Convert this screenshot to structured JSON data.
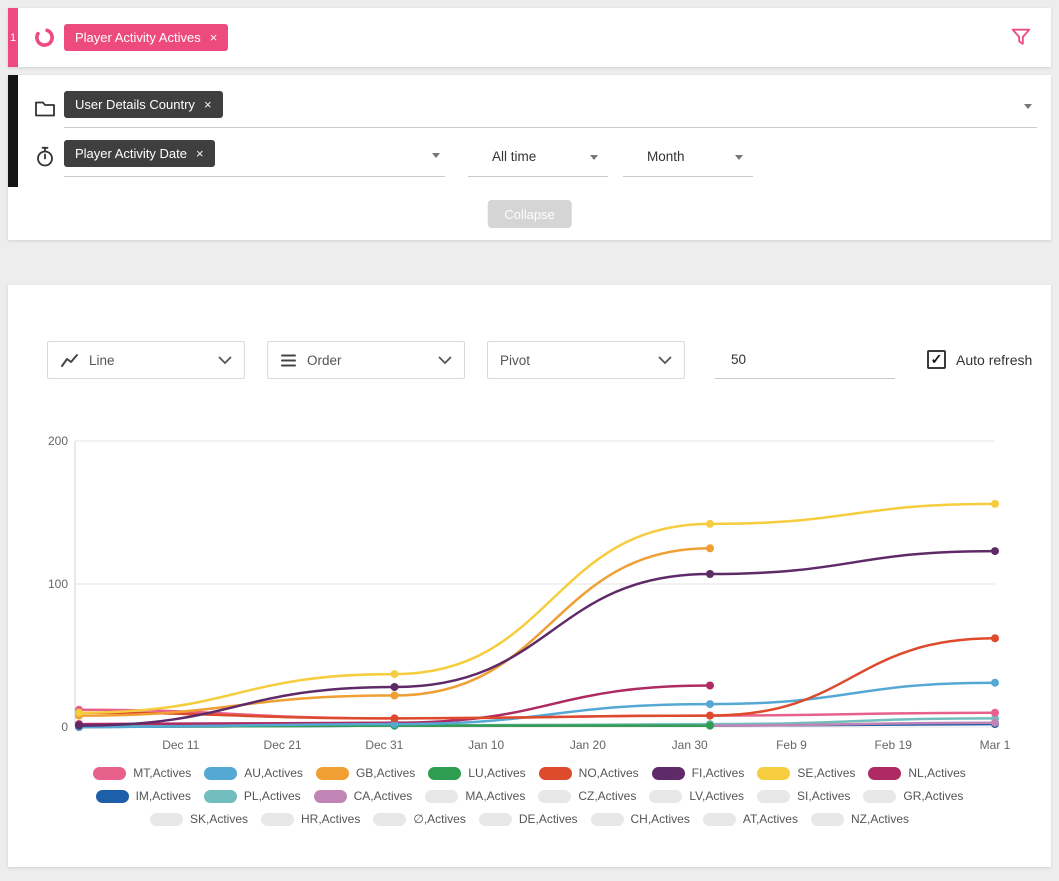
{
  "ui": {
    "row_number": "1",
    "close_glyph": "×",
    "check_glyph": "✓"
  },
  "query_builder": {
    "measure_chip": {
      "label": "Player Activity Actives"
    },
    "dimension_chip": {
      "label": "User Details Country"
    },
    "time_chip": {
      "label": "Player Activity Date"
    },
    "date_range": "All time",
    "granularity": "Month",
    "collapse_label": "Collapse"
  },
  "chart_controls": {
    "chart_type": "Line",
    "order_label": "Order",
    "pivot_label": "Pivot",
    "limit": "50",
    "auto_refresh_label": "Auto refresh"
  },
  "chart_data": {
    "type": "line",
    "title": "",
    "x": [
      "Dec 1",
      "Jan 1",
      "Feb 1",
      "Mar 1"
    ],
    "x_day_offsets": [
      0,
      31,
      62,
      90
    ],
    "x_ticks": [
      {
        "label": "Dec 11",
        "day": 10
      },
      {
        "label": "Dec 21",
        "day": 20
      },
      {
        "label": "Dec 31",
        "day": 30
      },
      {
        "label": "Jan 10",
        "day": 40
      },
      {
        "label": "Jan 20",
        "day": 50
      },
      {
        "label": "Jan 30",
        "day": 60
      },
      {
        "label": "Feb 9",
        "day": 70
      },
      {
        "label": "Feb 19",
        "day": 80
      },
      {
        "label": "Mar 1",
        "day": 90
      }
    ],
    "ylim": [
      0,
      200
    ],
    "y_ticks": [
      0,
      100,
      200
    ],
    "grid": true,
    "legend_position": "bottom",
    "series": [
      {
        "name": "IM,Actives",
        "color": "#1d5fa8",
        "values": [
          0,
          1,
          1,
          2
        ]
      },
      {
        "name": "PL,Actives",
        "color": "#72bdbd",
        "values": [
          1,
          1,
          2,
          6
        ]
      },
      {
        "name": "CA,Actives",
        "color": "#c185b5",
        "values": [
          0,
          1,
          1,
          3
        ]
      },
      {
        "name": "LU,Actives",
        "color": "#2f9e52",
        "values": [
          0,
          1,
          1,
          null
        ]
      },
      {
        "name": "MT,Actives",
        "color": "#e8618c",
        "values": [
          12,
          6,
          8,
          10
        ]
      },
      {
        "name": "NL,Actives",
        "color": "#ae2a62",
        "values": [
          2,
          3,
          29,
          null
        ]
      },
      {
        "name": "AU,Actives",
        "color": "#55a8d4",
        "values": [
          0,
          2,
          16,
          31
        ]
      },
      {
        "name": "NO,Actives",
        "color": "#dd4a2c",
        "values": [
          10,
          6,
          8,
          62
        ]
      },
      {
        "name": "GB,Actives",
        "color": "#f09f33",
        "values": [
          8,
          22,
          125,
          null
        ]
      },
      {
        "name": "FI,Actives",
        "color": "#5f2a68",
        "values": [
          1,
          28,
          107,
          123
        ]
      },
      {
        "name": "SE,Actives",
        "color": "#f6cd3e",
        "values": [
          10,
          37,
          142,
          156
        ]
      }
    ]
  },
  "legend": {
    "disabled_color": "#e7e7e7",
    "rows": [
      [
        {
          "label": "MT,Actives",
          "color": "#e8618c",
          "enabled": true
        },
        {
          "label": "AU,Actives",
          "color": "#55a8d4",
          "enabled": true
        },
        {
          "label": "GB,Actives",
          "color": "#f09f33",
          "enabled": true
        },
        {
          "label": "LU,Actives",
          "color": "#2f9e52",
          "enabled": true
        },
        {
          "label": "NO,Actives",
          "color": "#dd4a2c",
          "enabled": true
        },
        {
          "label": "FI,Actives",
          "color": "#5f2a68",
          "enabled": true
        },
        {
          "label": "SE,Actives",
          "color": "#f6cd3e",
          "enabled": true
        },
        {
          "label": "NL,Actives",
          "color": "#ae2a62",
          "enabled": true
        }
      ],
      [
        {
          "label": "IM,Actives",
          "color": "#1d5fa8",
          "enabled": true
        },
        {
          "label": "PL,Actives",
          "color": "#72bdbd",
          "enabled": true
        },
        {
          "label": "CA,Actives",
          "color": "#c185b5",
          "enabled": true
        },
        {
          "label": "MA,Actives",
          "color": "#e7e7e7",
          "enabled": false
        },
        {
          "label": "CZ,Actives",
          "color": "#e7e7e7",
          "enabled": false
        },
        {
          "label": "LV,Actives",
          "color": "#e7e7e7",
          "enabled": false
        },
        {
          "label": "SI,Actives",
          "color": "#e7e7e7",
          "enabled": false
        },
        {
          "label": "GR,Actives",
          "color": "#e7e7e7",
          "enabled": false
        }
      ],
      [
        {
          "label": "SK,Actives",
          "color": "#e7e7e7",
          "enabled": false
        },
        {
          "label": "HR,Actives",
          "color": "#e7e7e7",
          "enabled": false
        },
        {
          "label": "∅,Actives",
          "color": "#e7e7e7",
          "enabled": false
        },
        {
          "label": "DE,Actives",
          "color": "#e7e7e7",
          "enabled": false
        },
        {
          "label": "CH,Actives",
          "color": "#e7e7e7",
          "enabled": false
        },
        {
          "label": "AT,Actives",
          "color": "#e7e7e7",
          "enabled": false
        },
        {
          "label": "NZ,Actives",
          "color": "#e7e7e7",
          "enabled": false
        }
      ]
    ]
  }
}
